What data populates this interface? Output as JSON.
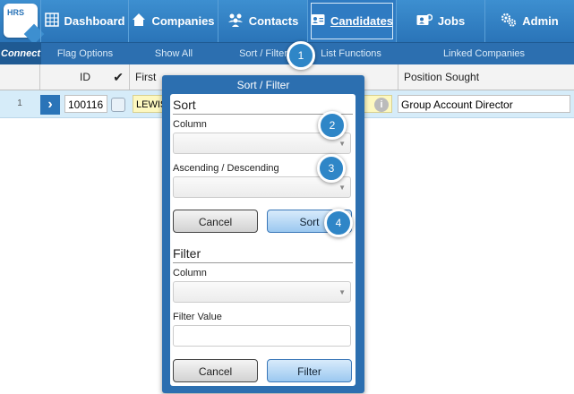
{
  "logo": {
    "text": "HRS"
  },
  "nav": {
    "tabs": [
      {
        "label": "Dashboard",
        "icon": "grid-icon"
      },
      {
        "label": "Companies",
        "icon": "house-icon"
      },
      {
        "label": "Contacts",
        "icon": "people-icon"
      },
      {
        "label": "Candidates",
        "icon": "id-card-icon",
        "active": true
      },
      {
        "label": "Jobs",
        "icon": "jobs-icon"
      },
      {
        "label": "Admin",
        "icon": "gears-icon"
      }
    ]
  },
  "subnav": {
    "connect": "Connect",
    "items": [
      "Flag Options",
      "Show All",
      "Sort / Filter",
      "List Functions",
      "Linked Companies"
    ]
  },
  "table": {
    "headers": {
      "id": "ID",
      "first": "First",
      "position": "Position Sought"
    },
    "rows": [
      {
        "num": "1",
        "id": "100116",
        "name": "LEWIS",
        "position": "Group Account Director"
      }
    ]
  },
  "popup": {
    "title": "Sort / Filter",
    "sort": {
      "heading": "Sort",
      "column_label": "Column",
      "order_label": "Ascending / Descending",
      "cancel": "Cancel",
      "submit": "Sort"
    },
    "filter": {
      "heading": "Filter",
      "column_label": "Column",
      "value_label": "Filter Value",
      "cancel": "Cancel",
      "submit": "Filter"
    }
  },
  "callouts": [
    "1",
    "2",
    "3",
    "4"
  ],
  "colors": {
    "nav": "#2a74b8",
    "subnav": "#2c6fb0",
    "row_selected": "#d6ecf9",
    "callout": "#2f86c7"
  }
}
